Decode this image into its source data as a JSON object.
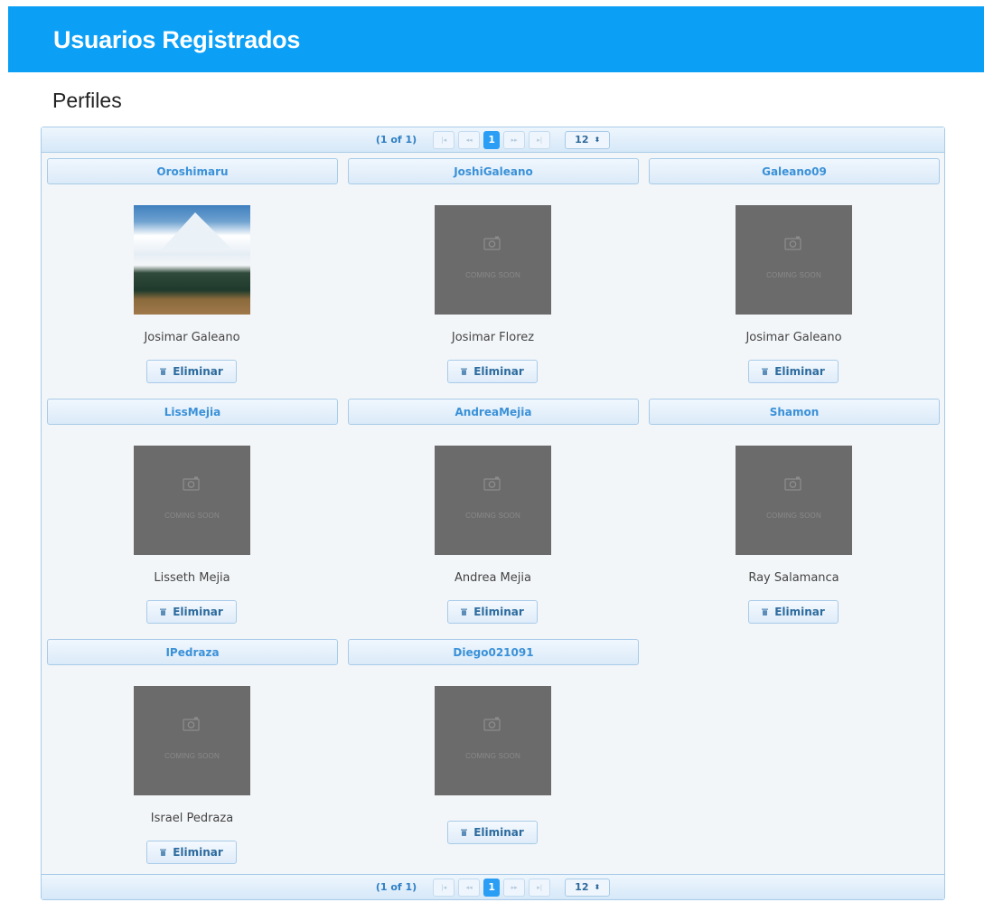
{
  "header": {
    "title": "Usuarios Registrados"
  },
  "section": {
    "title": "Perfiles"
  },
  "paginator": {
    "current": "(1 of 1)",
    "first_icon": "first-page-icon",
    "prev_icon": "prev-page-icon",
    "page": "1",
    "next_icon": "next-page-icon",
    "last_icon": "last-page-icon",
    "rows_per_page": "12",
    "rows_caret": "⬍"
  },
  "profiles": [
    {
      "username": "Oroshimaru",
      "fullname": "Josimar Galeano",
      "photo": "mountain-landscape",
      "delete_label": "Eliminar"
    },
    {
      "username": "JoshiGaleano",
      "fullname": "Josimar Florez",
      "photo": "placeholder",
      "placeholder_text": "COMING SOON",
      "delete_label": "Eliminar"
    },
    {
      "username": "Galeano09",
      "fullname": "Josimar Galeano",
      "photo": "placeholder",
      "placeholder_text": "COMING SOON",
      "delete_label": "Eliminar"
    },
    {
      "username": "LissMejia",
      "fullname": "Lisseth Mejia",
      "photo": "placeholder",
      "placeholder_text": "COMING SOON",
      "delete_label": "Eliminar"
    },
    {
      "username": "AndreaMejia",
      "fullname": "Andrea Mejia",
      "photo": "placeholder",
      "placeholder_text": "COMING SOON",
      "delete_label": "Eliminar"
    },
    {
      "username": "Shamon",
      "fullname": "Ray Salamanca",
      "photo": "placeholder",
      "placeholder_text": "COMING SOON",
      "delete_label": "Eliminar"
    },
    {
      "username": "IPedraza",
      "fullname": "Israel Pedraza",
      "photo": "placeholder",
      "placeholder_text": "COMING SOON",
      "delete_label": "Eliminar"
    },
    {
      "username": "Diego021091",
      "fullname": "",
      "photo": "placeholder",
      "placeholder_text": "COMING SOON",
      "delete_label": "Eliminar"
    }
  ],
  "colors": {
    "header_bg": "#0ba0f5",
    "accent": "#2a9df4",
    "placeholder_bg": "#6b6b6b"
  }
}
